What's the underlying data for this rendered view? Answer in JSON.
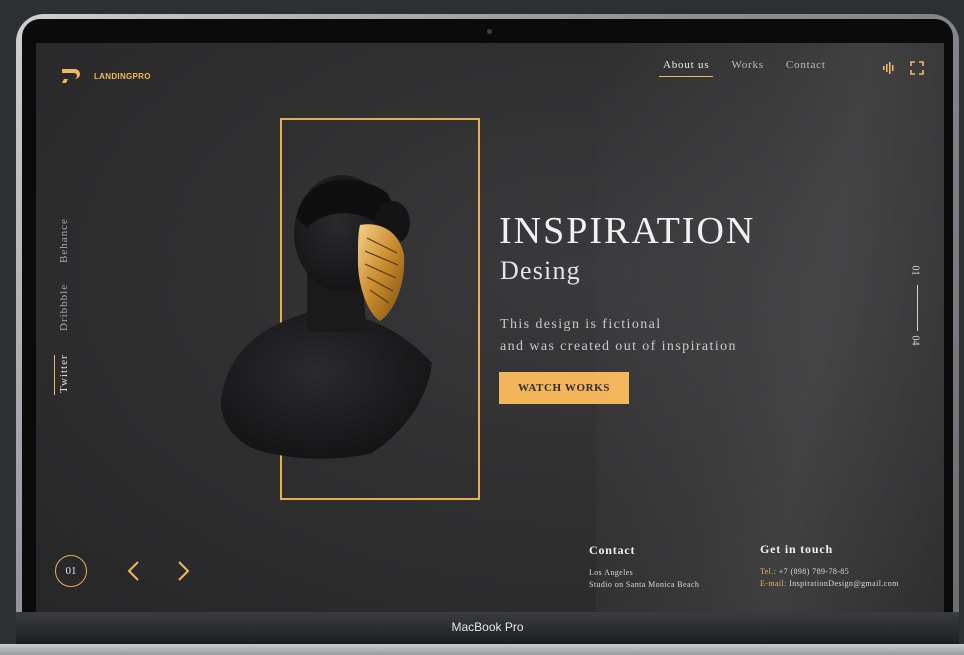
{
  "device": {
    "label": "MacBook Pro"
  },
  "site": {
    "brand": "LANDINGPRO",
    "nav": [
      {
        "label": "About us",
        "active": true
      },
      {
        "label": "Works",
        "active": false
      },
      {
        "label": "Contact",
        "active": false
      }
    ],
    "icons": [
      "sound-icon",
      "fullscreen-icon"
    ],
    "social": [
      {
        "label": "Twitter",
        "active": true
      },
      {
        "label": "Dribbble",
        "active": false
      },
      {
        "label": "Behance",
        "active": false
      }
    ],
    "hero": {
      "headline": "INSPIRATION",
      "subheadline": "Desing",
      "description_line1": "This design is fictional",
      "description_line2": "and was created out of inspiration",
      "cta": "Watch works"
    },
    "pager": {
      "current": "01",
      "total": "04"
    },
    "slider": {
      "current": "01"
    },
    "contact": {
      "title": "Contact",
      "line1": "Los Angeles",
      "line2": "Studio on Santa Monica Beach"
    },
    "get_in_touch": {
      "title": "Get in touch",
      "tel_label": "Tel.:",
      "tel_value": "+7 (898) 789-78-85",
      "email_label": "E-mail:",
      "email_value": "InspirationDesign@gmail.com"
    }
  },
  "colors": {
    "accent": "#f0b85c",
    "background": "#303031",
    "text": "#eaeaea"
  }
}
